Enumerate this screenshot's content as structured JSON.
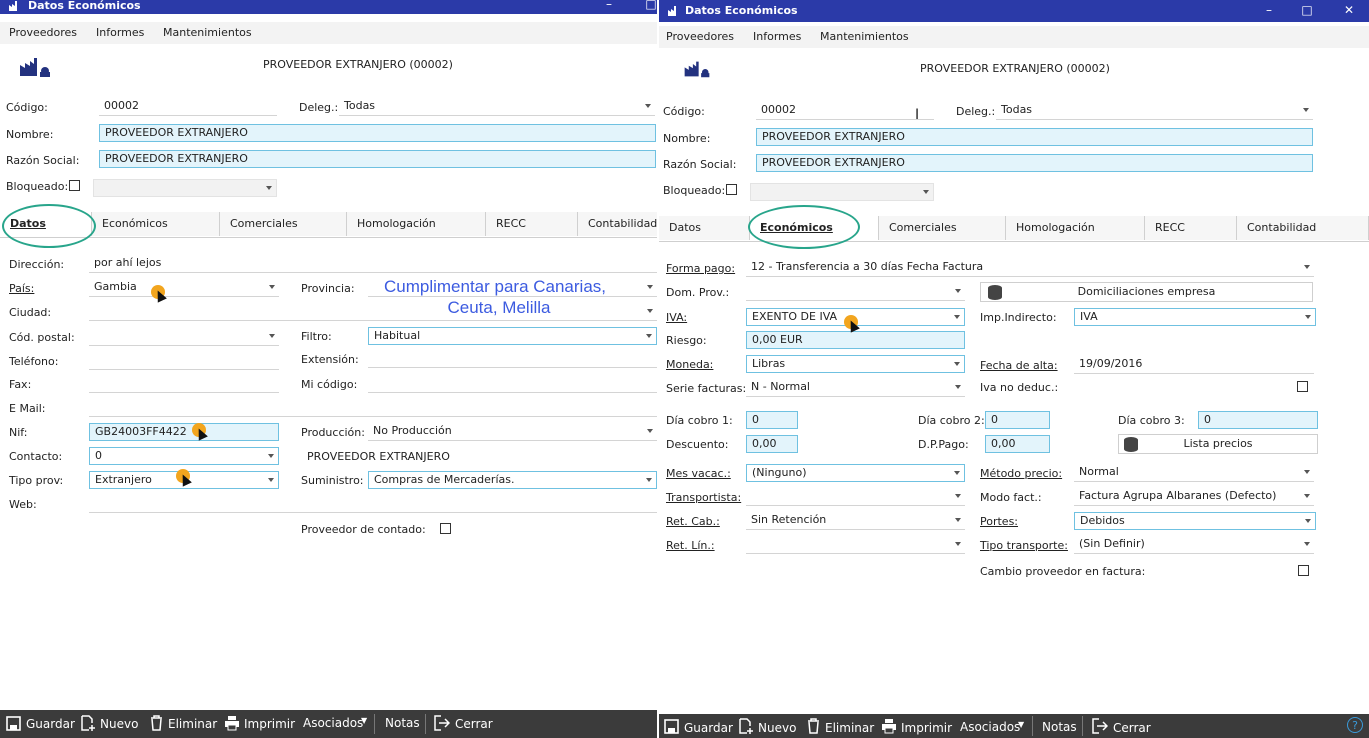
{
  "left": {
    "window": {
      "title": "Datos Económicos"
    },
    "menu": [
      "Proveedores",
      "Informes",
      "Mantenimientos"
    ],
    "header_title": "PROVEEDOR EXTRANJERO (00002)",
    "codigo": {
      "label": "Código:",
      "value": "00002"
    },
    "deleg": {
      "label": "Deleg.:",
      "value": "Todas"
    },
    "nombre": {
      "label": "Nombre:",
      "value": "PROVEEDOR EXTRANJERO"
    },
    "razon": {
      "label": "Razón Social:",
      "value": "PROVEEDOR EXTRANJERO"
    },
    "bloqueado": {
      "label": "Bloqueado:"
    },
    "tabs": [
      "Datos",
      "Económicos",
      "Comerciales",
      "Homologación",
      "RECC",
      "Contabilidad"
    ],
    "active_tab": "Datos",
    "fields": {
      "direccion": {
        "label": "Dirección:",
        "value": "por ahí lejos"
      },
      "pais": {
        "label": "País:",
        "value": "Gambia"
      },
      "provincia": {
        "label": "Provincia:",
        "value": ""
      },
      "ciudad": {
        "label": "Ciudad:",
        "value": ""
      },
      "cod_postal": {
        "label": "Cód. postal:",
        "value": ""
      },
      "filtro": {
        "label": "Filtro:",
        "value": "Habitual"
      },
      "telefono": {
        "label": "Teléfono:",
        "value": ""
      },
      "extension": {
        "label": "Extensión:",
        "value": ""
      },
      "fax": {
        "label": "Fax:",
        "value": ""
      },
      "mi_codigo": {
        "label": "Mi código:",
        "value": ""
      },
      "email": {
        "label": "E Mail:",
        "value": ""
      },
      "nif": {
        "label": "Nif:",
        "value": "GB24003FF4422"
      },
      "produccion": {
        "label": "Producción:",
        "value": "No Producción"
      },
      "contacto": {
        "label": "Contacto:",
        "value": "0"
      },
      "contacto_name": "PROVEEDOR EXTRANJERO",
      "tipo_prov": {
        "label": "Tipo prov:",
        "value": "Extranjero"
      },
      "suministro": {
        "label": "Suministro:",
        "value": "Compras de Mercaderías."
      },
      "web": {
        "label": "Web:",
        "value": ""
      },
      "proveedor_contado": {
        "label": "Proveedor de contado:"
      }
    },
    "annotation": [
      "Cumplimentar para Canarias,",
      "Ceuta, Melilla"
    ],
    "toolbar": [
      "Guardar",
      "Nuevo",
      "Eliminar",
      "Imprimir",
      "Asociados",
      "Notas",
      "Cerrar"
    ]
  },
  "right": {
    "window": {
      "title": "Datos Económicos"
    },
    "menu": [
      "Proveedores",
      "Informes",
      "Mantenimientos"
    ],
    "header_title": "PROVEEDOR EXTRANJERO (00002)",
    "codigo": {
      "label": "Código:",
      "value": "00002"
    },
    "deleg": {
      "label": "Deleg.:",
      "value": "Todas"
    },
    "nombre": {
      "label": "Nombre:",
      "value": "PROVEEDOR EXTRANJERO"
    },
    "razon": {
      "label": "Razón Social:",
      "value": "PROVEEDOR EXTRANJERO"
    },
    "bloqueado": {
      "label": "Bloqueado:"
    },
    "tabs": [
      "Datos",
      "Económicos",
      "Comerciales",
      "Homologación",
      "RECC",
      "Contabilidad"
    ],
    "active_tab": "Económicos",
    "fields": {
      "forma_pago": {
        "label": "Forma pago:",
        "value": "12 - Transferencia a 30 días Fecha Factura"
      },
      "dom_prov": {
        "label": "Dom. Prov.:",
        "value": ""
      },
      "domiciliaciones": "Domiciliaciones empresa",
      "iva": {
        "label": "IVA:",
        "value": "EXENTO DE IVA"
      },
      "imp_indirecto": {
        "label": "Imp.Indirecto:",
        "value": "IVA"
      },
      "riesgo": {
        "label": "Riesgo:",
        "value": "0,00 EUR"
      },
      "moneda": {
        "label": "Moneda:",
        "value": "Libras"
      },
      "fecha_alta": {
        "label": "Fecha de alta:",
        "value": "19/09/2016"
      },
      "serie": {
        "label": "Serie facturas:",
        "value": "N - Normal"
      },
      "iva_no_deduc": {
        "label": "Iva no deduc.:"
      },
      "dia1": {
        "label": "Día cobro 1:",
        "value": "0"
      },
      "dia2": {
        "label": "Día cobro 2:",
        "value": "0"
      },
      "dia3": {
        "label": "Día cobro 3:",
        "value": "0"
      },
      "descuento": {
        "label": "Descuento:",
        "value": "0,00"
      },
      "dppago": {
        "label": "D.P.Pago:",
        "value": "0,00"
      },
      "lista_precios": "Lista precios",
      "mes_vacac": {
        "label": "Mes vacac.:",
        "value": "(Ninguno)"
      },
      "metodo_precio": {
        "label": "Método precio:",
        "value": "Normal"
      },
      "transportista": {
        "label": "Transportista:",
        "value": ""
      },
      "modo_fact": {
        "label": "Modo fact.:",
        "value": "Factura Agrupa Albaranes (Defecto)"
      },
      "ret_cab": {
        "label": "Ret. Cab.:",
        "value": "Sin Retención"
      },
      "portes": {
        "label": "Portes:",
        "value": "Debidos"
      },
      "ret_lin": {
        "label": "Ret. Lín.:",
        "value": ""
      },
      "tipo_transporte": {
        "label": "Tipo transporte:",
        "value": "(Sin Definir)"
      },
      "cambio_prov": {
        "label": "Cambio proveedor en factura:"
      }
    },
    "toolbar": [
      "Guardar",
      "Nuevo",
      "Eliminar",
      "Imprimir",
      "Asociados",
      "Notas",
      "Cerrar"
    ],
    "help": "?"
  },
  "icons": {
    "factory": "factory-icon",
    "save": "save-icon",
    "new": "new-icon",
    "delete": "trash-icon",
    "print": "printer-icon",
    "coins": "coins-icon",
    "close": "close-door-icon"
  }
}
